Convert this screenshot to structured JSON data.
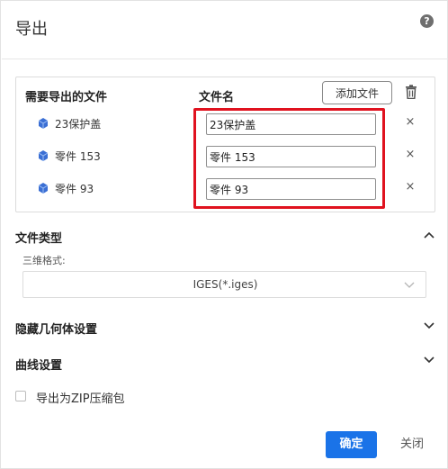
{
  "dialog": {
    "title": "导出"
  },
  "file_panel": {
    "header_files": "需要导出的文件",
    "header_name": "文件名",
    "add_button": "添加文件",
    "rows": [
      {
        "label": "23保护盖",
        "filename": "23保护盖"
      },
      {
        "label": "零件 153",
        "filename": "零件 153"
      },
      {
        "label": "零件 93",
        "filename": "零件 93"
      }
    ],
    "remove_glyph": "×"
  },
  "file_type": {
    "title": "文件类型",
    "format_label": "三维格式:",
    "format_value": "IGES(*.iges)"
  },
  "hidden_geometry": {
    "title": "隐藏几何体设置"
  },
  "curve_settings": {
    "title": "曲线设置"
  },
  "zip_option": {
    "label": "导出为ZIP压缩包"
  },
  "footer": {
    "ok": "确定",
    "close": "关闭"
  },
  "colors": {
    "accent": "#1a73e8",
    "highlight": "#e0121f",
    "part_icon": "#3b6fd4"
  },
  "icons": [
    "help-icon",
    "trash-icon",
    "part-icon",
    "close-icon",
    "chevron-up-icon",
    "chevron-down-icon"
  ]
}
